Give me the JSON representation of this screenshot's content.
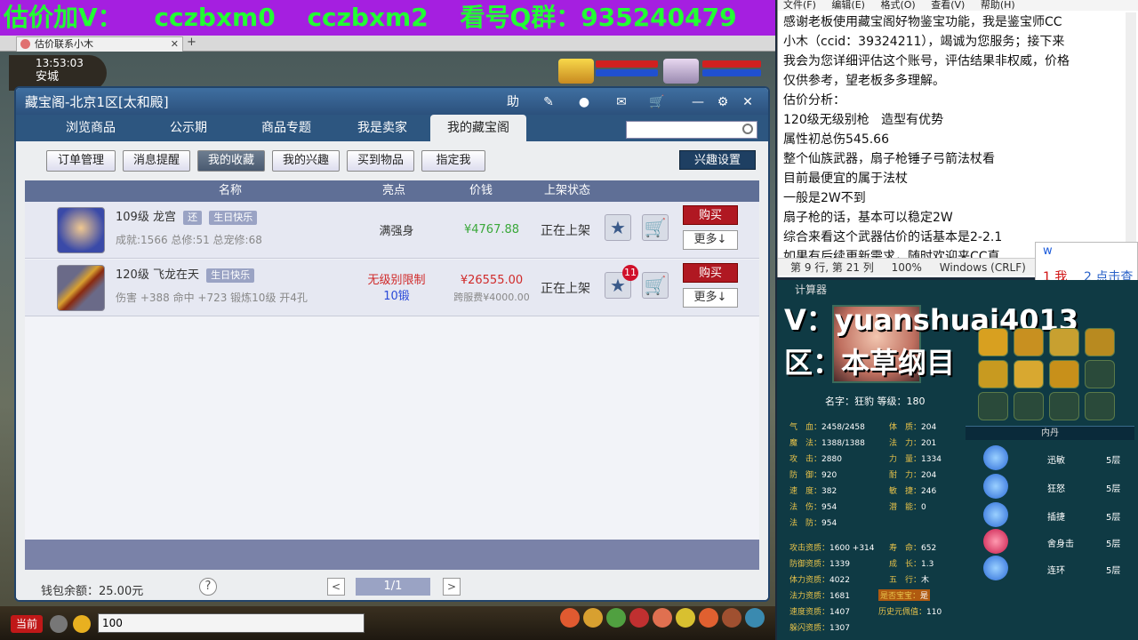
{
  "banner": {
    "parts": [
      "估价加V：",
      "cczbxm0",
      "cczbxm2",
      "看号Q群：935240479"
    ]
  },
  "browser": {
    "tab_title": "估价联系小木",
    "close": "✕",
    "new_tab": "+"
  },
  "game": {
    "time": "13:53:03",
    "city": "安城"
  },
  "panel": {
    "title": "藏宝阁-北京1区[太和殿]",
    "title_icons": [
      "助",
      "✎",
      "●",
      "✉",
      "🛒",
      "—",
      "⚙",
      "✕"
    ],
    "nav_tabs": [
      "浏览商品",
      "公示期",
      "商品专题",
      "我是卖家",
      "我的藏宝阁"
    ],
    "sub_tabs": [
      "订单管理",
      "消息提醒",
      "我的收藏",
      "我的兴趣",
      "买到物品",
      "指定我"
    ],
    "interest_button": "兴趣设置",
    "columns": [
      "名称",
      "亮点",
      "价钱",
      "上架状态"
    ],
    "rows": [
      {
        "level_name": "109级  龙宫",
        "tag1": "还",
        "tag2": "生日快乐",
        "detail": "成就:1566 总修:51 总宠修:68",
        "highlight": "满强身",
        "highlight2": "",
        "price": "¥4767.88",
        "price2": "",
        "status": "正在上架",
        "buy": "购买",
        "more": "更多↓"
      },
      {
        "level_name": "120级  飞龙在天",
        "tag1": "",
        "tag2": "生日快乐",
        "detail": "伤害 +388  命中 +723  锻炼10级  开4孔",
        "highlight": "无级别限制",
        "highlight2": "10锻",
        "price": "¥26555.00",
        "price2": "跨服费¥4000.00",
        "status": "正在上架",
        "badge": "11",
        "buy": "购买",
        "more": "更多↓"
      }
    ],
    "wallet": "钱包余额：25.00元",
    "help": "?",
    "prev": "<",
    "page": "1/1",
    "next": ">"
  },
  "chat": {
    "current": "当前",
    "input_value": "100"
  },
  "notepad": {
    "menu": [
      "文件(F)",
      "编辑(E)",
      "格式(O)",
      "查看(V)",
      "帮助(H)"
    ],
    "text": "感谢老板使用藏宝阁好物鉴宝功能，我是鉴宝师CC\n小木（ccid：39324211），竭诚为您服务；接下来\n我会为您详细评估这个账号，评估结果非权威，价格\n仅供参考，望老板多多理解。\n估价分析：\n120级无级别枪   造型有优势\n属性初总伤545.66\n整个仙族武器，扇子枪锤子弓箭法杖看\n目前最便宜的属于法杖\n一般是2W不到\n扇子枪的话，基本可以稳定2W\n综合来看这个武器估价的话基本是2-2.1\n如果有后续更新需求，随时欢迎来CC直",
    "status_pos": "第 9 行, 第 21 列",
    "status_zoom": "100%",
    "status_enc": "Windows (CRLF)"
  },
  "ime": {
    "input": "w",
    "cand1": "1 我",
    "cand2": "2 点击查"
  },
  "charpanel": {
    "calc_tab": "计算器",
    "stream_v": "V：yuanshuai4013",
    "stream_q": "区：本草纲目",
    "name_level": "名字：狂豹  等级：180",
    "stats": [
      {
        "k": "气　血：",
        "v": "2458/2458"
      },
      {
        "k": "魔　法：",
        "v": "1388/1388"
      },
      {
        "k": "攻　击：",
        "v": "2880"
      },
      {
        "k": "防　御：",
        "v": "920"
      },
      {
        "k": "速　度：",
        "v": "382"
      },
      {
        "k": "法　伤：",
        "v": "954"
      },
      {
        "k": "法　防：",
        "v": "954"
      }
    ],
    "stats_right": [
      {
        "k": "体　质：",
        "v": "204"
      },
      {
        "k": "法　力：",
        "v": "201"
      },
      {
        "k": "力　量：",
        "v": "1334"
      },
      {
        "k": "耐　力：",
        "v": "204"
      },
      {
        "k": "敏　捷：",
        "v": "246"
      },
      {
        "k": "潜　能：",
        "v": "0"
      }
    ],
    "neidan_title": "内丹",
    "neidan": [
      {
        "name": "迅敏",
        "lv": "5层",
        "color": "#2a6ad8"
      },
      {
        "name": "狂怒",
        "lv": "5层",
        "color": "#2a6ad8"
      },
      {
        "name": "插捷",
        "lv": "5层",
        "color": "#2a6ad8"
      },
      {
        "name": "舍身击",
        "lv": "5层",
        "color": "#c8184a"
      },
      {
        "name": "连环",
        "lv": "5层",
        "color": "#2a6ad8"
      }
    ],
    "stats2": [
      {
        "k": "攻击资质：",
        "v": "1600 +314"
      },
      {
        "k": "防御资质：",
        "v": "1339"
      },
      {
        "k": "体力资质：",
        "v": "4022"
      },
      {
        "k": "法力资质：",
        "v": "1681"
      },
      {
        "k": "速度资质：",
        "v": "1407"
      },
      {
        "k": "躲闪资质：",
        "v": "1307"
      }
    ],
    "stats2_right": [
      {
        "k": "寿　命：",
        "v": "652"
      },
      {
        "k": "成　长：",
        "v": "1.3"
      },
      {
        "k": "五　行：",
        "v": "木"
      },
      {
        "k": "是否宝宝：",
        "v": "是"
      },
      {
        "k": "历史元佩值：",
        "v": "110"
      }
    ]
  }
}
